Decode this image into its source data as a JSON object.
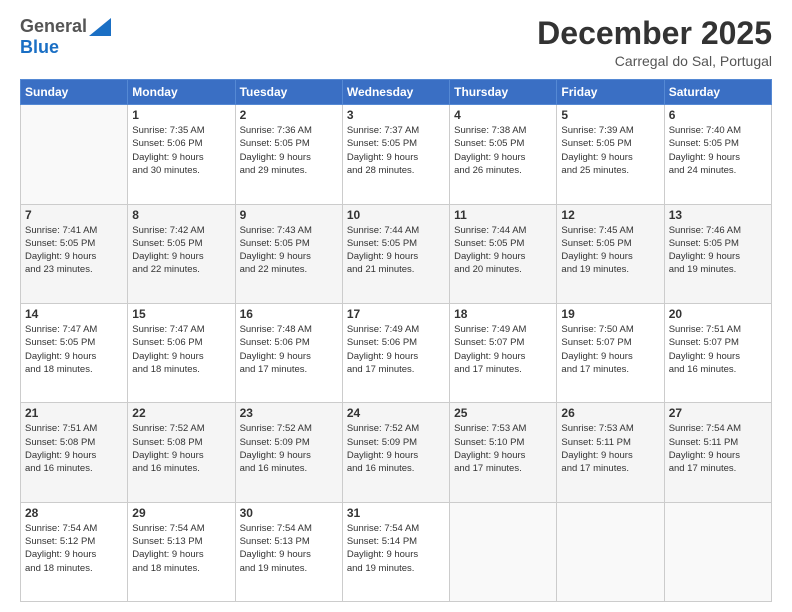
{
  "logo": {
    "general": "General",
    "blue": "Blue"
  },
  "header": {
    "month": "December 2025",
    "location": "Carregal do Sal, Portugal"
  },
  "days_of_week": [
    "Sunday",
    "Monday",
    "Tuesday",
    "Wednesday",
    "Thursday",
    "Friday",
    "Saturday"
  ],
  "weeks": [
    [
      {
        "day": "",
        "info": ""
      },
      {
        "day": "1",
        "info": "Sunrise: 7:35 AM\nSunset: 5:06 PM\nDaylight: 9 hours\nand 30 minutes."
      },
      {
        "day": "2",
        "info": "Sunrise: 7:36 AM\nSunset: 5:05 PM\nDaylight: 9 hours\nand 29 minutes."
      },
      {
        "day": "3",
        "info": "Sunrise: 7:37 AM\nSunset: 5:05 PM\nDaylight: 9 hours\nand 28 minutes."
      },
      {
        "day": "4",
        "info": "Sunrise: 7:38 AM\nSunset: 5:05 PM\nDaylight: 9 hours\nand 26 minutes."
      },
      {
        "day": "5",
        "info": "Sunrise: 7:39 AM\nSunset: 5:05 PM\nDaylight: 9 hours\nand 25 minutes."
      },
      {
        "day": "6",
        "info": "Sunrise: 7:40 AM\nSunset: 5:05 PM\nDaylight: 9 hours\nand 24 minutes."
      }
    ],
    [
      {
        "day": "7",
        "info": "Sunrise: 7:41 AM\nSunset: 5:05 PM\nDaylight: 9 hours\nand 23 minutes."
      },
      {
        "day": "8",
        "info": "Sunrise: 7:42 AM\nSunset: 5:05 PM\nDaylight: 9 hours\nand 22 minutes."
      },
      {
        "day": "9",
        "info": "Sunrise: 7:43 AM\nSunset: 5:05 PM\nDaylight: 9 hours\nand 22 minutes."
      },
      {
        "day": "10",
        "info": "Sunrise: 7:44 AM\nSunset: 5:05 PM\nDaylight: 9 hours\nand 21 minutes."
      },
      {
        "day": "11",
        "info": "Sunrise: 7:44 AM\nSunset: 5:05 PM\nDaylight: 9 hours\nand 20 minutes."
      },
      {
        "day": "12",
        "info": "Sunrise: 7:45 AM\nSunset: 5:05 PM\nDaylight: 9 hours\nand 19 minutes."
      },
      {
        "day": "13",
        "info": "Sunrise: 7:46 AM\nSunset: 5:05 PM\nDaylight: 9 hours\nand 19 minutes."
      }
    ],
    [
      {
        "day": "14",
        "info": "Sunrise: 7:47 AM\nSunset: 5:05 PM\nDaylight: 9 hours\nand 18 minutes."
      },
      {
        "day": "15",
        "info": "Sunrise: 7:47 AM\nSunset: 5:06 PM\nDaylight: 9 hours\nand 18 minutes."
      },
      {
        "day": "16",
        "info": "Sunrise: 7:48 AM\nSunset: 5:06 PM\nDaylight: 9 hours\nand 17 minutes."
      },
      {
        "day": "17",
        "info": "Sunrise: 7:49 AM\nSunset: 5:06 PM\nDaylight: 9 hours\nand 17 minutes."
      },
      {
        "day": "18",
        "info": "Sunrise: 7:49 AM\nSunset: 5:07 PM\nDaylight: 9 hours\nand 17 minutes."
      },
      {
        "day": "19",
        "info": "Sunrise: 7:50 AM\nSunset: 5:07 PM\nDaylight: 9 hours\nand 17 minutes."
      },
      {
        "day": "20",
        "info": "Sunrise: 7:51 AM\nSunset: 5:07 PM\nDaylight: 9 hours\nand 16 minutes."
      }
    ],
    [
      {
        "day": "21",
        "info": "Sunrise: 7:51 AM\nSunset: 5:08 PM\nDaylight: 9 hours\nand 16 minutes."
      },
      {
        "day": "22",
        "info": "Sunrise: 7:52 AM\nSunset: 5:08 PM\nDaylight: 9 hours\nand 16 minutes."
      },
      {
        "day": "23",
        "info": "Sunrise: 7:52 AM\nSunset: 5:09 PM\nDaylight: 9 hours\nand 16 minutes."
      },
      {
        "day": "24",
        "info": "Sunrise: 7:52 AM\nSunset: 5:09 PM\nDaylight: 9 hours\nand 16 minutes."
      },
      {
        "day": "25",
        "info": "Sunrise: 7:53 AM\nSunset: 5:10 PM\nDaylight: 9 hours\nand 17 minutes."
      },
      {
        "day": "26",
        "info": "Sunrise: 7:53 AM\nSunset: 5:11 PM\nDaylight: 9 hours\nand 17 minutes."
      },
      {
        "day": "27",
        "info": "Sunrise: 7:54 AM\nSunset: 5:11 PM\nDaylight: 9 hours\nand 17 minutes."
      }
    ],
    [
      {
        "day": "28",
        "info": "Sunrise: 7:54 AM\nSunset: 5:12 PM\nDaylight: 9 hours\nand 18 minutes."
      },
      {
        "day": "29",
        "info": "Sunrise: 7:54 AM\nSunset: 5:13 PM\nDaylight: 9 hours\nand 18 minutes."
      },
      {
        "day": "30",
        "info": "Sunrise: 7:54 AM\nSunset: 5:13 PM\nDaylight: 9 hours\nand 19 minutes."
      },
      {
        "day": "31",
        "info": "Sunrise: 7:54 AM\nSunset: 5:14 PM\nDaylight: 9 hours\nand 19 minutes."
      },
      {
        "day": "",
        "info": ""
      },
      {
        "day": "",
        "info": ""
      },
      {
        "day": "",
        "info": ""
      }
    ]
  ]
}
